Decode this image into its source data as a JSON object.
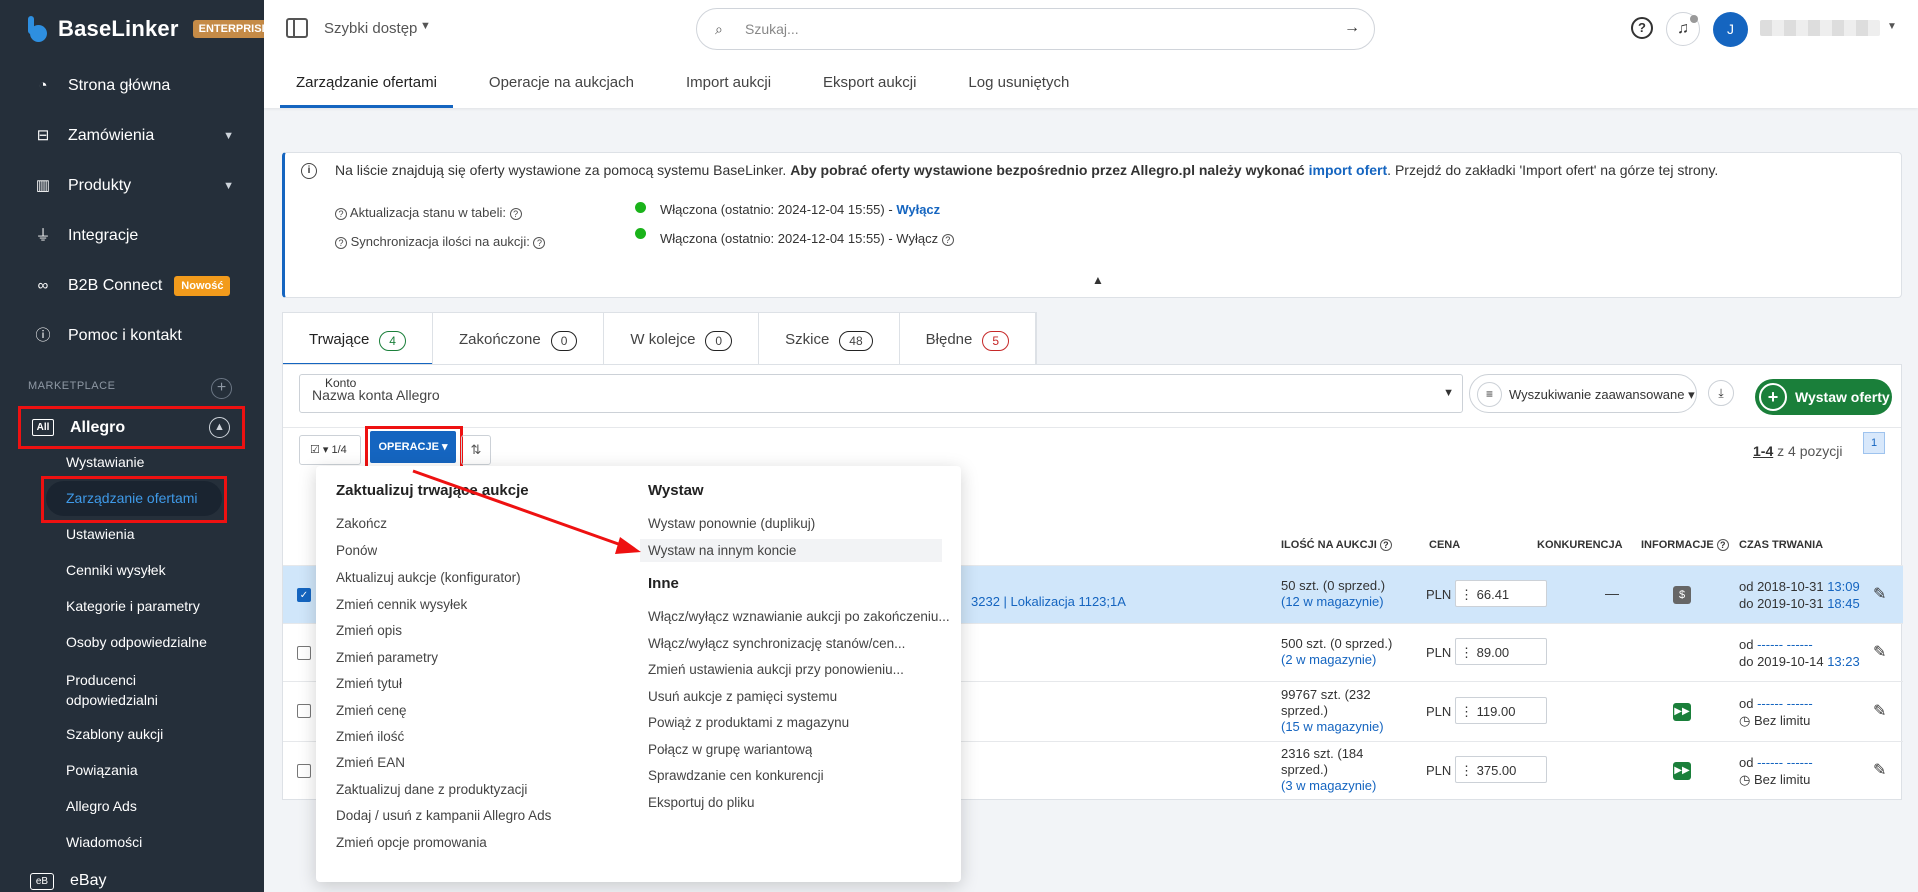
{
  "brand": {
    "name": "BaseLinker",
    "edition": "ENTERPRISE"
  },
  "sidebar": {
    "items": [
      {
        "label": "Strona główna",
        "icon": "dashboard-icon"
      },
      {
        "label": "Zamówienia",
        "icon": "cart-icon"
      },
      {
        "label": "Produkty",
        "icon": "factory-icon"
      },
      {
        "label": "Integracje",
        "icon": "plug-icon"
      },
      {
        "label": "B2B Connect",
        "icon": "link-icon",
        "badge": "Nowość"
      },
      {
        "label": "Pomoc i kontakt",
        "icon": "help-icon"
      }
    ],
    "section_label": "MARKETPLACE",
    "allegro": {
      "icon_text": "All",
      "label": "Allegro"
    },
    "allegro_sub": [
      "Wystawianie",
      "Zarządzanie ofertami",
      "Ustawienia",
      "Cenniki wysyłek",
      "Kategorie i parametry",
      "Osoby odpowiedzialne",
      "Producenci odpowiedzialni",
      "Szablony aukcji",
      "Powiązania",
      "Allegro Ads",
      "Wiadomości"
    ],
    "ebay": {
      "icon_text": "eB",
      "label": "eBay"
    }
  },
  "topbar": {
    "quick_access": "Szybki dostęp",
    "search_placeholder": "Szukaj...",
    "avatar_initial": "J",
    "tabs": [
      "Zarządzanie ofertami",
      "Operacje na aukcjach",
      "Import aukcji",
      "Eksport aukcji",
      "Log usuniętych"
    ]
  },
  "info": {
    "text_start": "Na liście znajdują się oferty wystawione za pomocą systemu BaseLinker.",
    "text_bold": "Aby pobrać oferty wystawione bezpośrednio przez Allegro.pl należy wykonać",
    "text_link": "import ofert",
    "text_end": ". Przejdź do zakładki 'Import ofert' na górze tej strony.",
    "row1_label": "Aktualizacja stanu w tabeli:",
    "row1_value": "Włączona (ostatnio: 2024-12-04 15:55) -",
    "row1_link": "Wyłącz",
    "row2_label": "Synchronizacja ilości na aukcji:",
    "row2_value": "Włączona (ostatnio: 2024-12-04 15:55) - Wyłącz"
  },
  "status_tabs": [
    {
      "label": "Trwające",
      "count": "4"
    },
    {
      "label": "Zakończone",
      "count": "0"
    },
    {
      "label": "W kolejce",
      "count": "0"
    },
    {
      "label": "Szkice",
      "count": "48"
    },
    {
      "label": "Błędne",
      "count": "5"
    }
  ],
  "filters": {
    "account_label": "Konto",
    "account_value": "Nazwa konta Allegro",
    "advanced_search": "Wyszukiwanie zaawansowane",
    "list_button": "Wystaw oferty"
  },
  "toolbar": {
    "selection": "1/4",
    "operations": "OPERACJE",
    "pager_range": "1-4",
    "pager_rest": "z 4 pozycji",
    "page": "1"
  },
  "table": {
    "headers": {
      "qty": "ILOŚĆ NA AUKCJI",
      "price": "CENA",
      "competition": "KONKURENCJA",
      "info": "INFORMACJE",
      "duration": "CZAS TRWANIA"
    },
    "first_row_location": "3232 | Lokalizacja 1123;1A",
    "rows": [
      {
        "checked": true,
        "qty": "50 szt. (0 sprzed.)",
        "stock": "(12 w magazynie)",
        "currency": "PLN",
        "price": "66.41",
        "competition": "—",
        "info_icon": "dollar-icon",
        "dur1": "od 2018-10-31",
        "dur1_time": "13:09",
        "dur2": "do 2019-10-31",
        "dur2_time": "18:45"
      },
      {
        "checked": false,
        "qty": "500 szt. (0 sprzed.)",
        "stock": "(2 w magazynie)",
        "currency": "PLN",
        "price": "89.00",
        "competition": "",
        "info_icon": "",
        "dur1": "od",
        "dur1_time": "------ ------",
        "dur2": "do 2019-10-14",
        "dur2_time": "13:23"
      },
      {
        "checked": false,
        "qty": "99767 szt. (232 sprzed.)",
        "stock": "(15 w magazynie)",
        "currency": "PLN",
        "price": "119.00",
        "competition": "",
        "info_icon": "forward-icon",
        "dur1": "od",
        "dur1_time": "------ ------",
        "dur2": "Bez limitu",
        "dur2_time": ""
      },
      {
        "checked": false,
        "qty": "2316 szt. (184 sprzed.)",
        "stock": "(3 w magazynie)",
        "currency": "PLN",
        "price": "375.00",
        "competition": "",
        "info_icon": "forward-icon",
        "dur1": "od",
        "dur1_time": "------ ------",
        "dur2": "Bez limitu",
        "dur2_time": ""
      }
    ]
  },
  "menu": {
    "left_title": "Zaktualizuj trwające aukcje",
    "left_items": [
      "Zakończ",
      "Ponów",
      "Aktualizuj aukcje (konfigurator)",
      "Zmień cennik wysyłek",
      "Zmień opis",
      "Zmień parametry",
      "Zmień tytuł",
      "Zmień cenę",
      "Zmień ilość",
      "Zmień EAN",
      "Zaktualizuj dane z produktyzacji",
      "Dodaj / usuń z kampanii Allegro Ads",
      "Zmień opcje promowania"
    ],
    "right_title": "Wystaw",
    "right_items": [
      "Wystaw ponownie (duplikuj)",
      "Wystaw na innym koncie"
    ],
    "other_title": "Inne",
    "other_items": [
      "Włącz/wyłącz wznawianie aukcji po zakończeniu...",
      "Włącz/wyłącz synchronizację stanów/cen...",
      "Zmień ustawienia aukcji przy ponowieniu...",
      "Usuń aukcje z pamięci systemu",
      "Powiąż z produktami z magazynu",
      "Połącz w grupę wariantową",
      "Sprawdzanie cen konkurencji",
      "Eksportuj do pliku"
    ]
  },
  "colors": {
    "accent": "#1565c0",
    "sidebar": "#252f3a",
    "success": "#1a7f3a",
    "highlight": "#ee1111"
  }
}
